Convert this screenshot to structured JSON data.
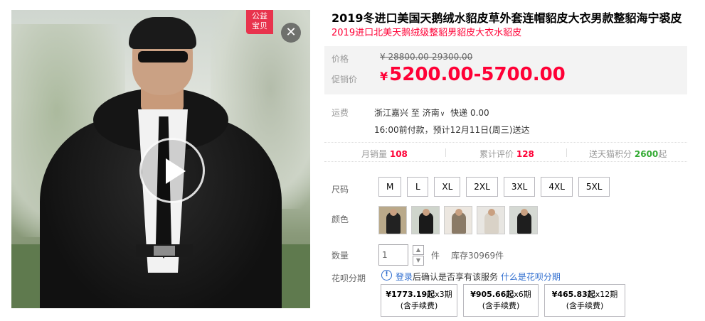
{
  "gallery": {
    "badge_line1": "公益",
    "badge_line2": "宝贝",
    "close_symbol": "✕"
  },
  "product": {
    "title": "2019冬进口美国天鹅绒水貂皮草外套连帽貂皮大衣男款整貂海宁裘皮",
    "subtitle": "2019进口北美天鹅绒级整貂男貂皮大衣水貂皮"
  },
  "price": {
    "label_original": "价格",
    "label_sale": "促销价",
    "currency": "¥",
    "original": "28800.00-29300.00",
    "sale": "5200.00-5700.00",
    "accent_color": "#ff0036"
  },
  "shipping": {
    "label": "运费",
    "origin": "浙江嘉兴",
    "to": "至",
    "destination": "济南",
    "method": "快递 0.00",
    "delivery_note": "16:00前付款，预计12月11日(周三)送达"
  },
  "stats": {
    "monthly_sales_label": "月销量",
    "monthly_sales": "108",
    "reviews_label": "累计评价",
    "reviews": "128",
    "points_label": "送天猫积分",
    "points": "2600",
    "points_suffix": "起"
  },
  "options": {
    "size_label": "尺码",
    "sizes": [
      "M",
      "L",
      "XL",
      "2XL",
      "3XL",
      "4XL",
      "5XL"
    ],
    "color_label": "颜色"
  },
  "quantity": {
    "label": "数量",
    "value": "1",
    "unit": "件",
    "stock": "库存30969件"
  },
  "huabei": {
    "label": "花呗分期",
    "login": "登录",
    "notice": "后确认是否享有该服务",
    "what_link": "什么是花呗分期",
    "plans": [
      {
        "amount": "¥1773.19起",
        "periods": "x3期",
        "fee": "(含手续费)"
      },
      {
        "amount": "¥905.66起",
        "periods": "x6期",
        "fee": "(含手续费)"
      },
      {
        "amount": "¥465.83起",
        "periods": "x12期",
        "fee": "(含手续费)"
      }
    ]
  }
}
